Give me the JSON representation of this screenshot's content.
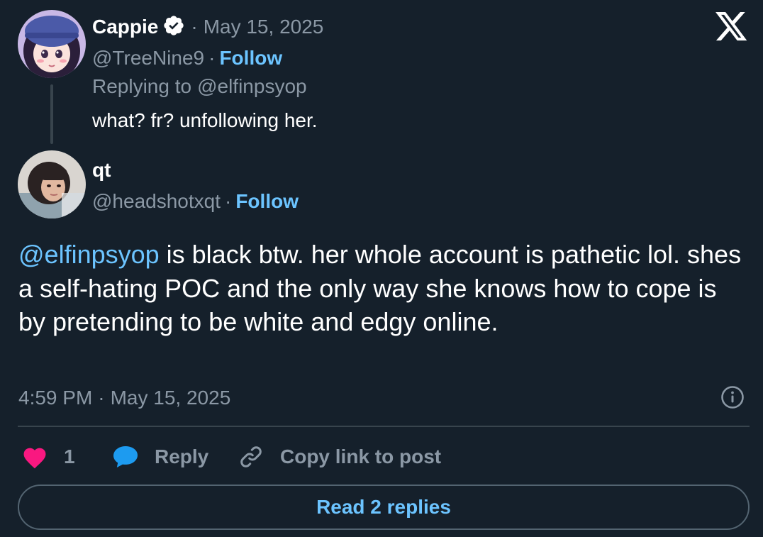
{
  "parent_post": {
    "author_name": "Cappie",
    "separator": "·",
    "date": "May 15, 2025",
    "handle": "@TreeNine9",
    "follow_label": "Follow",
    "replying_to_prefix": "Replying to",
    "replying_to_handle": "@elfinpsyop",
    "text": "what? fr? unfollowing her."
  },
  "main_post": {
    "author_name": "qt",
    "handle": "@headshotxqt",
    "separator": "·",
    "follow_label": "Follow",
    "mention": "@elfinpsyop",
    "text_after_mention": " is black btw. her whole account is pathetic lol. shes a self-hating POC and the only way she knows how to cope is by pretending to be white and edgy online.",
    "time": "4:59 PM",
    "date": "May 15, 2025"
  },
  "actions": {
    "like_count": "1",
    "reply_label": "Reply",
    "copy_link_label": "Copy link to post"
  },
  "read_replies_label": "Read 2 replies",
  "colors": {
    "background": "#15202b",
    "accent": "#6cc4ff",
    "muted": "#8b98a5",
    "like": "#f91880",
    "reply_bubble": "#1d9bf0"
  }
}
